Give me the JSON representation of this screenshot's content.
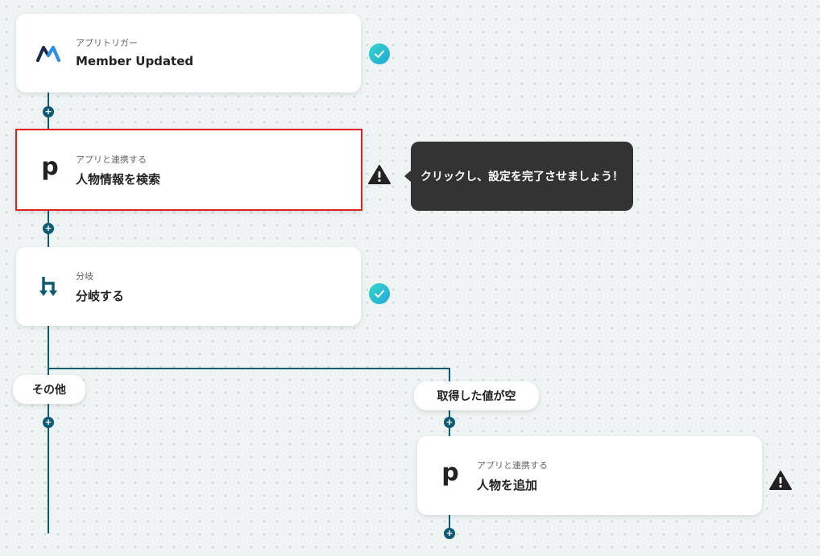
{
  "nodes": [
    {
      "id": "trigger",
      "label": "アプリトリガー",
      "title": "Member Updated",
      "icon": "memberstack-logo-icon",
      "status": "complete"
    },
    {
      "id": "search",
      "label": "アプリと連携する",
      "title": "人物情報を検索",
      "icon": "p-logo-icon",
      "status": "warning"
    },
    {
      "id": "branch",
      "label": "分岐",
      "title": "分岐する",
      "icon": "branch-icon",
      "status": "complete"
    },
    {
      "id": "add",
      "label": "アプリと連携する",
      "title": "人物を追加",
      "icon": "p-logo-icon",
      "status": "warning"
    }
  ],
  "tooltip": {
    "text": "クリックし、設定を完了させましょう！"
  },
  "branches": {
    "other": "その他",
    "empty": "取得した値が空"
  },
  "plus_symbol": "+",
  "logo_letter": "p",
  "colors": {
    "line": "#0d5a73",
    "check": "#26c0d3",
    "selected_border": "#e02020",
    "tooltip_bg": "#333333"
  }
}
